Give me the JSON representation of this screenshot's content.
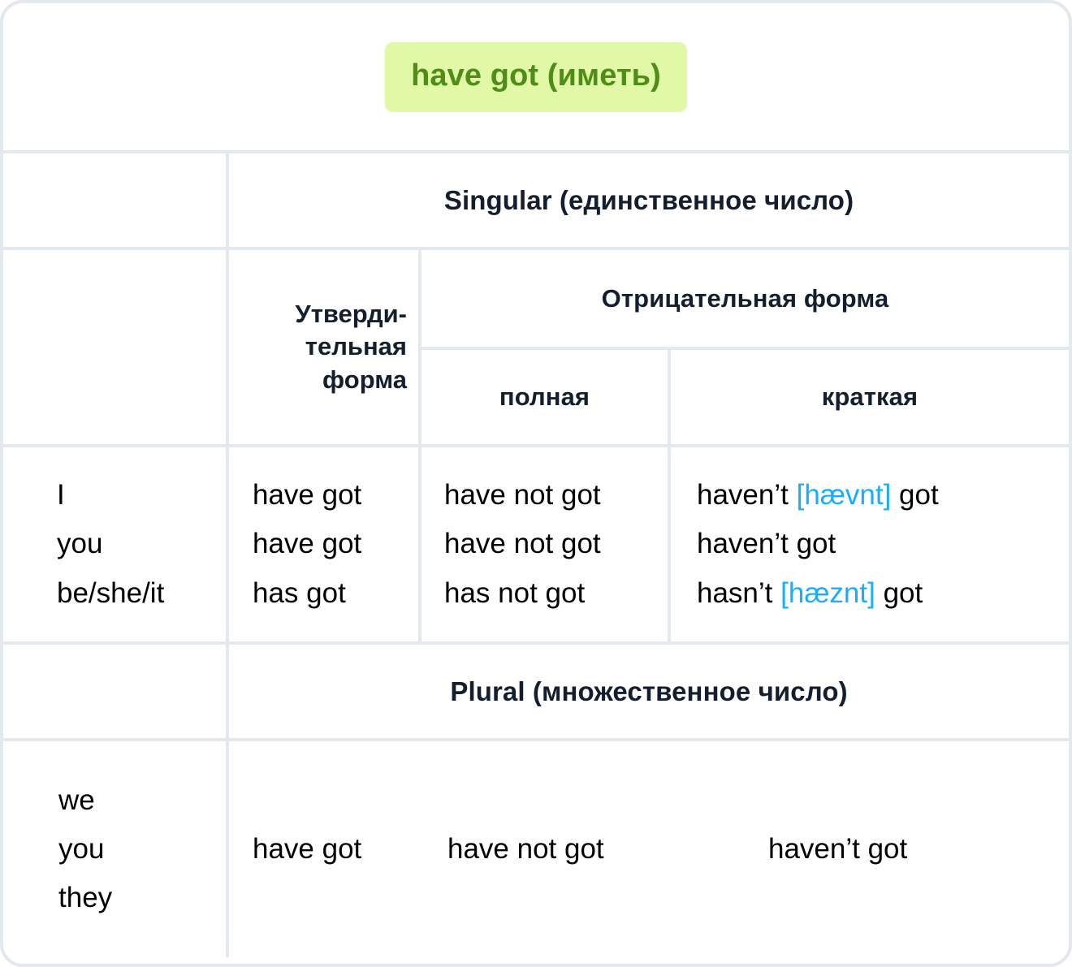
{
  "title": {
    "badge": "have got (иметь)"
  },
  "colors": {
    "badge_bg": "#e1f8a6",
    "badge_text": "#508d18",
    "heading_text": "#131f2e",
    "body_text": "#000000",
    "ipa_text": "#19adff",
    "border": "#e3e8ee"
  },
  "headers": {
    "singular": "Singular (единственное число)",
    "plural": "Plural (множественное число)",
    "affirmative": "Утверди-\nтельная\nформа",
    "affirmative_lines": [
      "Утверди-",
      "тельная",
      "форма"
    ],
    "negative": "Отрицательная форма",
    "negative_full": "полная",
    "negative_short": "краткая"
  },
  "singular": {
    "pronouns": [
      "I",
      "you",
      "be/she/it"
    ],
    "affirmative": [
      "have got",
      "have got",
      "has got"
    ],
    "negative_full": [
      "have not got",
      "have not got",
      "has not got"
    ],
    "negative_short": [
      {
        "before": "haven’t ",
        "ipa": "[hævnt]",
        "after": " got"
      },
      {
        "before": "haven’t got",
        "ipa": "",
        "after": ""
      },
      {
        "before": "hasn’t ",
        "ipa": "[hæznt]",
        "after": " got"
      }
    ]
  },
  "plural": {
    "pronouns": [
      "we",
      "you",
      "they"
    ],
    "affirmative": "have got",
    "negative_full": "have not got",
    "negative_short": "haven’t got"
  }
}
